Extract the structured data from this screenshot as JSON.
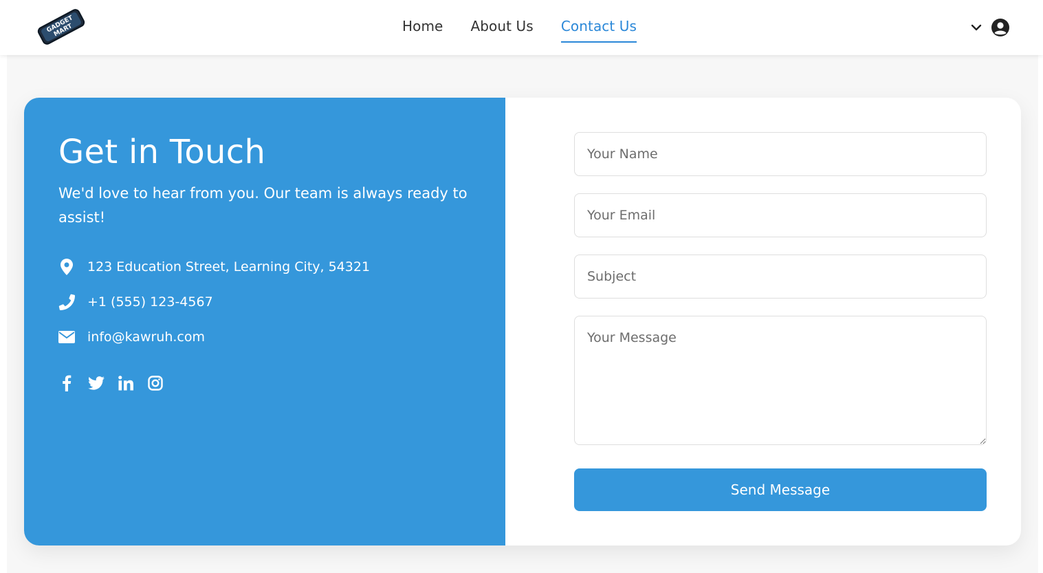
{
  "header": {
    "logo_text": "GADGET MART",
    "nav": [
      {
        "label": "Home"
      },
      {
        "label": "About Us"
      },
      {
        "label": "Contact Us"
      }
    ],
    "active_nav": "Contact Us"
  },
  "contact": {
    "title": "Get in Touch",
    "subtitle": "We'd love to hear from you. Our team is always ready to assist!",
    "address": "123 Education Street, Learning City, 54321",
    "phone": "+1 (555) 123-4567",
    "email": "info@kawruh.com",
    "socials": [
      "facebook-icon",
      "twitter-icon",
      "linkedin-icon",
      "instagram-icon"
    ]
  },
  "form": {
    "name_placeholder": "Your Name",
    "email_placeholder": "Your Email",
    "subject_placeholder": "Subject",
    "message_placeholder": "Your Message",
    "submit_label": "Send Message"
  },
  "colors": {
    "accent": "#3597db",
    "nav_active": "#2b88d8"
  }
}
